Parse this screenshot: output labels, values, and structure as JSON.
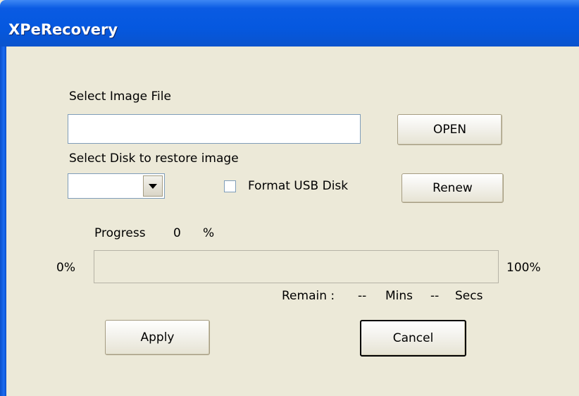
{
  "window": {
    "title": "XPeRecovery"
  },
  "image_file": {
    "label": "Select Image File",
    "value": "",
    "open_label": "OPEN"
  },
  "disk": {
    "label": "Select Disk to restore image",
    "selected": "",
    "format_label": "Format USB Disk",
    "format_checked": false,
    "renew_label": "Renew"
  },
  "progress": {
    "label": "Progress",
    "value": "0",
    "unit": "%",
    "fraction": 0,
    "min_label": "0%",
    "max_label": "100%"
  },
  "remain": {
    "label": "Remain :",
    "mins_value": "--",
    "mins_label": "Mins",
    "secs_value": "--",
    "secs_label": "Secs"
  },
  "actions": {
    "apply_label": "Apply",
    "cancel_label": "Cancel"
  }
}
